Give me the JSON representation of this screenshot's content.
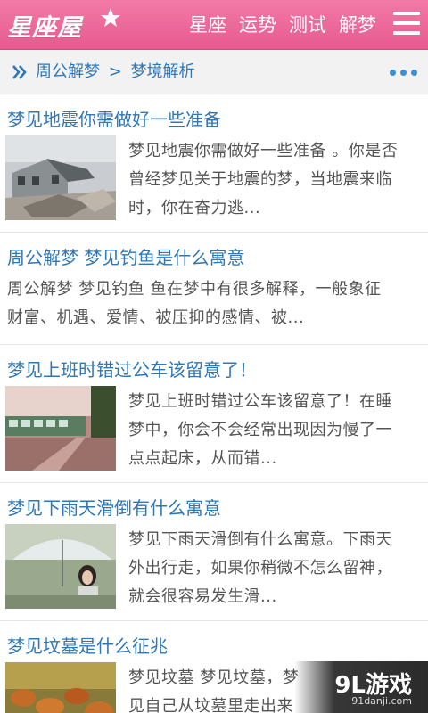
{
  "header": {
    "logo": "星座屋",
    "nav": [
      "星座",
      "运势",
      "测试",
      "解梦"
    ],
    "colors": {
      "bar": "#ec6a9c",
      "text": "#ffffff"
    }
  },
  "breadcrumb": {
    "root": "周公解梦",
    "separator": ">",
    "current": "梦境解析"
  },
  "articles": [
    {
      "title": "梦见地震你需做好一些准备",
      "desc_lines": [
        "梦见地震你需做好一些准备 。你是否",
        "曾经梦见关于地震的梦，当地震来临",
        "时，你在奋力逃..."
      ],
      "has_image": true,
      "image": "earthquake-photo"
    },
    {
      "title": "周公解梦 梦见钓鱼是什么寓意",
      "desc_lines": [
        "周公解梦 梦见钓鱼 鱼在梦中有很多解释，一般象征",
        "财富、机遇、爱情、被压抑的感情、被..."
      ],
      "has_image": false
    },
    {
      "title": "梦见上班时错过公车该留意了！",
      "desc_lines": [
        "梦见上班时错过公车该留意了！在睡",
        "梦中，你会不会经常出现因为慢了一",
        "点点起床，从而错..."
      ],
      "has_image": true,
      "image": "train-station-photo"
    },
    {
      "title": "梦见下雨天滑倒有什么寓意",
      "desc_lines": [
        "梦见下雨天滑倒有什么寓意。下雨天",
        "外出行走，如果你稍微不怎么留神，",
        "就会很容易发生滑..."
      ],
      "has_image": true,
      "image": "umbrella-girl-photo"
    },
    {
      "title": "梦见坟墓是什么征兆",
      "desc_lines": [
        "梦见坟墓 梦见坟墓，梦",
        "见自己从坟墓里走出来"
      ],
      "has_image": true,
      "image": "graveyard-photo"
    }
  ],
  "watermark": {
    "main": "9L游戏",
    "sub": "91danji.com"
  }
}
